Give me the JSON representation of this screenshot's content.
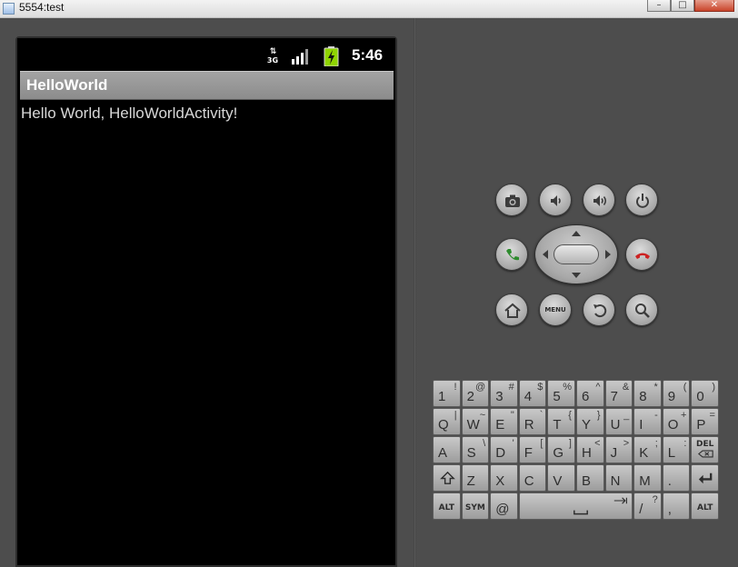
{
  "window": {
    "title": "5554:test",
    "minimize": "–",
    "maximize": "□",
    "close": "✕"
  },
  "status_bar": {
    "network": "3G",
    "time": "5:46",
    "icons": [
      "network-3g-icon",
      "signal-icon",
      "battery-icon"
    ]
  },
  "app": {
    "title": "HelloWorld",
    "content": "Hello World, HelloWorldActivity!"
  },
  "hardware_buttons": {
    "row1": [
      "camera-icon",
      "volume-down-icon",
      "volume-up-icon",
      "power-icon"
    ],
    "row2": [
      "call-icon",
      "dpad",
      "end-call-icon"
    ],
    "row3": [
      "home-icon",
      "menu-button",
      "back-icon",
      "search-icon"
    ],
    "menu_label": "MENU"
  },
  "colors": {
    "call": "#2e8b2e",
    "end_call": "#cc2222",
    "battery": "#8fd400"
  },
  "keyboard": {
    "row1": [
      {
        "main": "1",
        "alt": "!"
      },
      {
        "main": "2",
        "alt": "@"
      },
      {
        "main": "3",
        "alt": "#"
      },
      {
        "main": "4",
        "alt": "$"
      },
      {
        "main": "5",
        "alt": "%"
      },
      {
        "main": "6",
        "alt": "^"
      },
      {
        "main": "7",
        "alt": "&"
      },
      {
        "main": "8",
        "alt": "*"
      },
      {
        "main": "9",
        "alt": "("
      },
      {
        "main": "0",
        "alt": ")"
      }
    ],
    "row2": [
      {
        "main": "Q",
        "alt": "|"
      },
      {
        "main": "W",
        "alt": "~"
      },
      {
        "main": "E",
        "alt": "\""
      },
      {
        "main": "R",
        "alt": "`"
      },
      {
        "main": "T",
        "alt": "{"
      },
      {
        "main": "Y",
        "alt": "}"
      },
      {
        "main": "U",
        "alt": "_"
      },
      {
        "main": "I",
        "alt": "-"
      },
      {
        "main": "O",
        "alt": "+"
      },
      {
        "main": "P",
        "alt": "="
      }
    ],
    "row3": [
      {
        "main": "A",
        "alt": ""
      },
      {
        "main": "S",
        "alt": "\\"
      },
      {
        "main": "D",
        "alt": "'"
      },
      {
        "main": "F",
        "alt": "["
      },
      {
        "main": "G",
        "alt": "]"
      },
      {
        "main": "H",
        "alt": "<"
      },
      {
        "main": "J",
        "alt": ">"
      },
      {
        "main": "K",
        "alt": ";"
      },
      {
        "main": "L",
        "alt": ":"
      },
      {
        "main": "DEL",
        "alt": ""
      }
    ],
    "row4": [
      {
        "main": "shift",
        "alt": ""
      },
      {
        "main": "Z",
        "alt": ""
      },
      {
        "main": "X",
        "alt": ""
      },
      {
        "main": "C",
        "alt": ""
      },
      {
        "main": "V",
        "alt": ""
      },
      {
        "main": "B",
        "alt": ""
      },
      {
        "main": "N",
        "alt": ""
      },
      {
        "main": "M",
        "alt": ""
      },
      {
        "main": ".",
        "alt": ""
      },
      {
        "main": "enter",
        "alt": ""
      }
    ],
    "row5": [
      {
        "main": "ALT"
      },
      {
        "main": "SYM"
      },
      {
        "main": "@"
      },
      {
        "main": "space"
      },
      {
        "main": "/",
        "alt": "?"
      },
      {
        "main": ",",
        "alt": ""
      },
      {
        "main": "ALT"
      }
    ]
  }
}
